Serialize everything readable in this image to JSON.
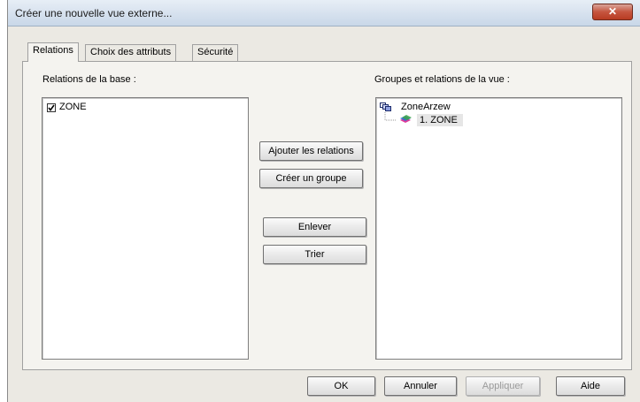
{
  "window": {
    "title": "Créer une nouvelle vue externe...",
    "close_glyph": "✕"
  },
  "tabs": [
    {
      "label": "Relations",
      "active": true
    },
    {
      "label": "Choix des attributs",
      "active": false
    },
    {
      "label": "Sécurité",
      "active": false
    }
  ],
  "left_panel": {
    "label": "Relations de la base :",
    "items": [
      {
        "label": "ZONE",
        "checked": true
      }
    ]
  },
  "right_panel": {
    "label": "Groupes et relations de la vue :",
    "tree": {
      "group": {
        "label": "ZoneArzew",
        "icon": "group-icon"
      },
      "children": [
        {
          "label": "1. ZONE",
          "icon": "relation-icon"
        }
      ]
    }
  },
  "middle_buttons": {
    "add_relations": "Ajouter les relations",
    "create_group": "Créer un groupe",
    "remove": "Enlever",
    "sort": "Trier"
  },
  "footer_buttons": {
    "ok": "OK",
    "cancel": "Annuler",
    "apply": "Appliquer",
    "help": "Aide"
  }
}
